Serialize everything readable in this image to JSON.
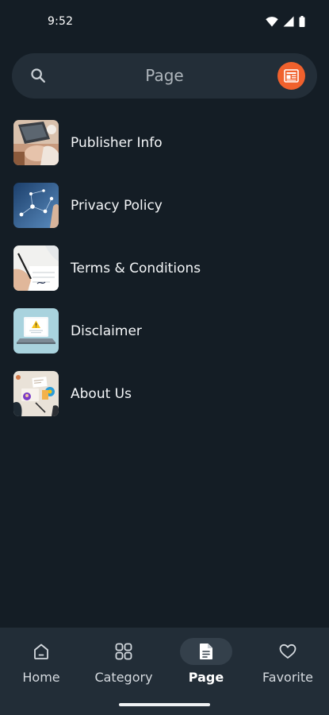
{
  "status_bar": {
    "time": "9:52"
  },
  "search": {
    "title": "Page"
  },
  "pages": [
    {
      "label": "Publisher Info",
      "icon": "laptop-desk-photo"
    },
    {
      "label": "Privacy Policy",
      "icon": "network-touch-photo"
    },
    {
      "label": "Terms & Conditions",
      "icon": "signing-document-photo"
    },
    {
      "label": "Disclaimer",
      "icon": "laptop-warning-illustration"
    },
    {
      "label": "About Us",
      "icon": "workspace-flatlay-photo"
    }
  ],
  "bottom_nav": {
    "items": [
      {
        "label": "Home",
        "icon": "home-icon"
      },
      {
        "label": "Category",
        "icon": "grid-icon"
      },
      {
        "label": "Page",
        "icon": "document-icon",
        "active": true
      },
      {
        "label": "Favorite",
        "icon": "heart-icon"
      }
    ]
  },
  "colors": {
    "background": "#141d25",
    "search_bar": "#232e38",
    "accent": "#f0612d",
    "nav_background": "#222d37",
    "nav_active_pill": "#34404b"
  }
}
